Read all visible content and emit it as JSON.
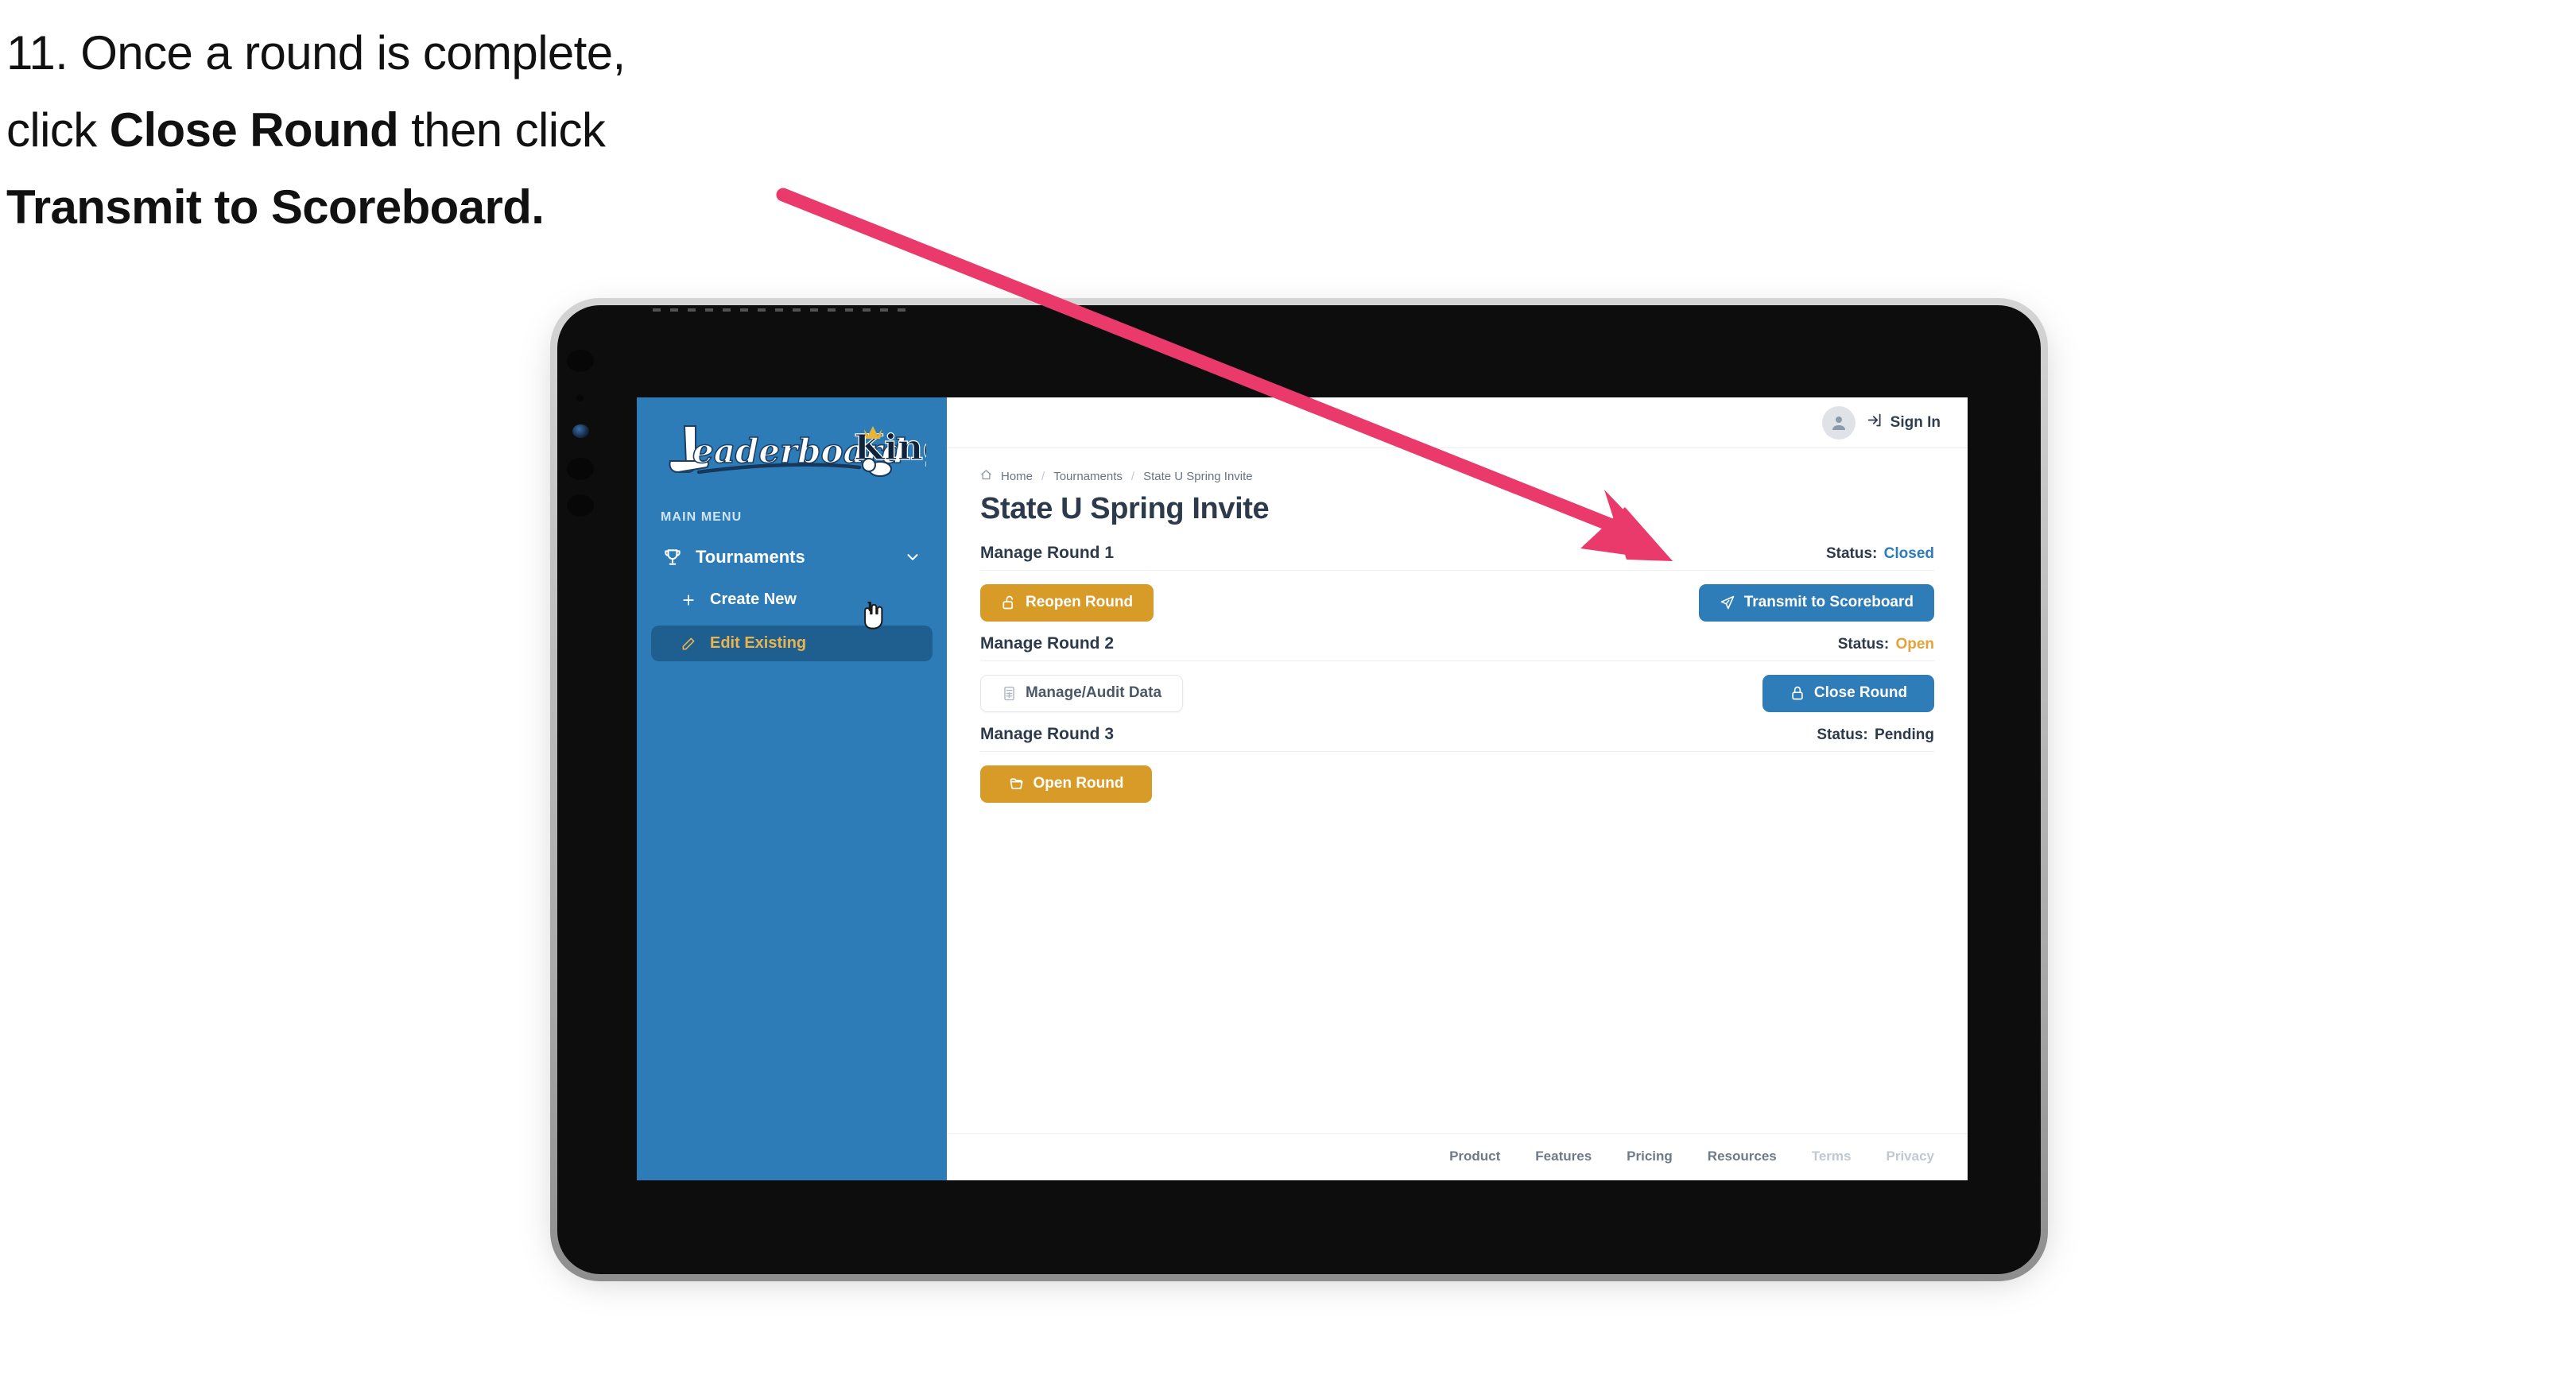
{
  "caption": {
    "line1": "11. Once a round is complete,",
    "line2_pre": "click ",
    "line2_bold": "Close Round",
    "line2_post": " then click",
    "line3_bold": "Transmit to Scoreboard."
  },
  "annotation": {
    "arrow_color": "#ea3a6c",
    "points_to": "Transmit to Scoreboard"
  },
  "device": {
    "type": "tablet",
    "frame_color": "#b4b4b4",
    "body_color": "#0d0d0d"
  },
  "sidebar": {
    "logo_primary": "Leaderboard",
    "logo_secondary": "King",
    "menu_label": "MAIN MENU",
    "parent": {
      "label": "Tournaments",
      "icon": "trophy-icon",
      "chevron": "chevron-down-icon"
    },
    "items": [
      {
        "label": "Create New",
        "icon": "plus-icon",
        "active": false
      },
      {
        "label": "Edit Existing",
        "icon": "edit-pencil-icon",
        "active": true
      }
    ],
    "bg_color": "#2d7cb8",
    "active_bg": "#1f5f90",
    "active_text": "#e9b44c"
  },
  "topbar": {
    "avatar_icon": "user-avatar-icon",
    "signin_icon": "login-arrow-icon",
    "signin_label": "Sign In"
  },
  "breadcrumb": {
    "home_icon": "home-icon",
    "items": [
      "Home",
      "Tournaments",
      "State U Spring Invite"
    ],
    "separator": "/"
  },
  "page": {
    "title": "State U Spring Invite"
  },
  "rounds": [
    {
      "name": "Manage Round 1",
      "status_label": "Status:",
      "status_value": "Closed",
      "status_color": "#2e7cb8",
      "left_button": {
        "label": "Reopen Round",
        "icon": "unlock-icon",
        "style": "amber"
      },
      "right_button": {
        "label": "Transmit to Scoreboard",
        "icon": "paper-plane-icon",
        "style": "blue"
      }
    },
    {
      "name": "Manage Round 2",
      "status_label": "Status:",
      "status_value": "Open",
      "status_color": "#e3a33a",
      "left_button": {
        "label": "Manage/Audit Data",
        "icon": "calculator-icon",
        "style": "ghost"
      },
      "right_button": {
        "label": "Close Round",
        "icon": "lock-icon",
        "style": "blue"
      }
    },
    {
      "name": "Manage Round 3",
      "status_label": "Status:",
      "status_value": "Pending",
      "status_color": "#2c3a4b",
      "left_button": {
        "label": "Open Round",
        "icon": "folder-open-icon",
        "style": "amber"
      },
      "right_button": null
    }
  ],
  "footer": {
    "links": [
      {
        "label": "Product",
        "muted": false
      },
      {
        "label": "Features",
        "muted": false
      },
      {
        "label": "Pricing",
        "muted": false
      },
      {
        "label": "Resources",
        "muted": false
      },
      {
        "label": "Terms",
        "muted": true
      },
      {
        "label": "Privacy",
        "muted": true
      }
    ]
  },
  "cursor": {
    "type": "pointing-hand-cursor"
  }
}
